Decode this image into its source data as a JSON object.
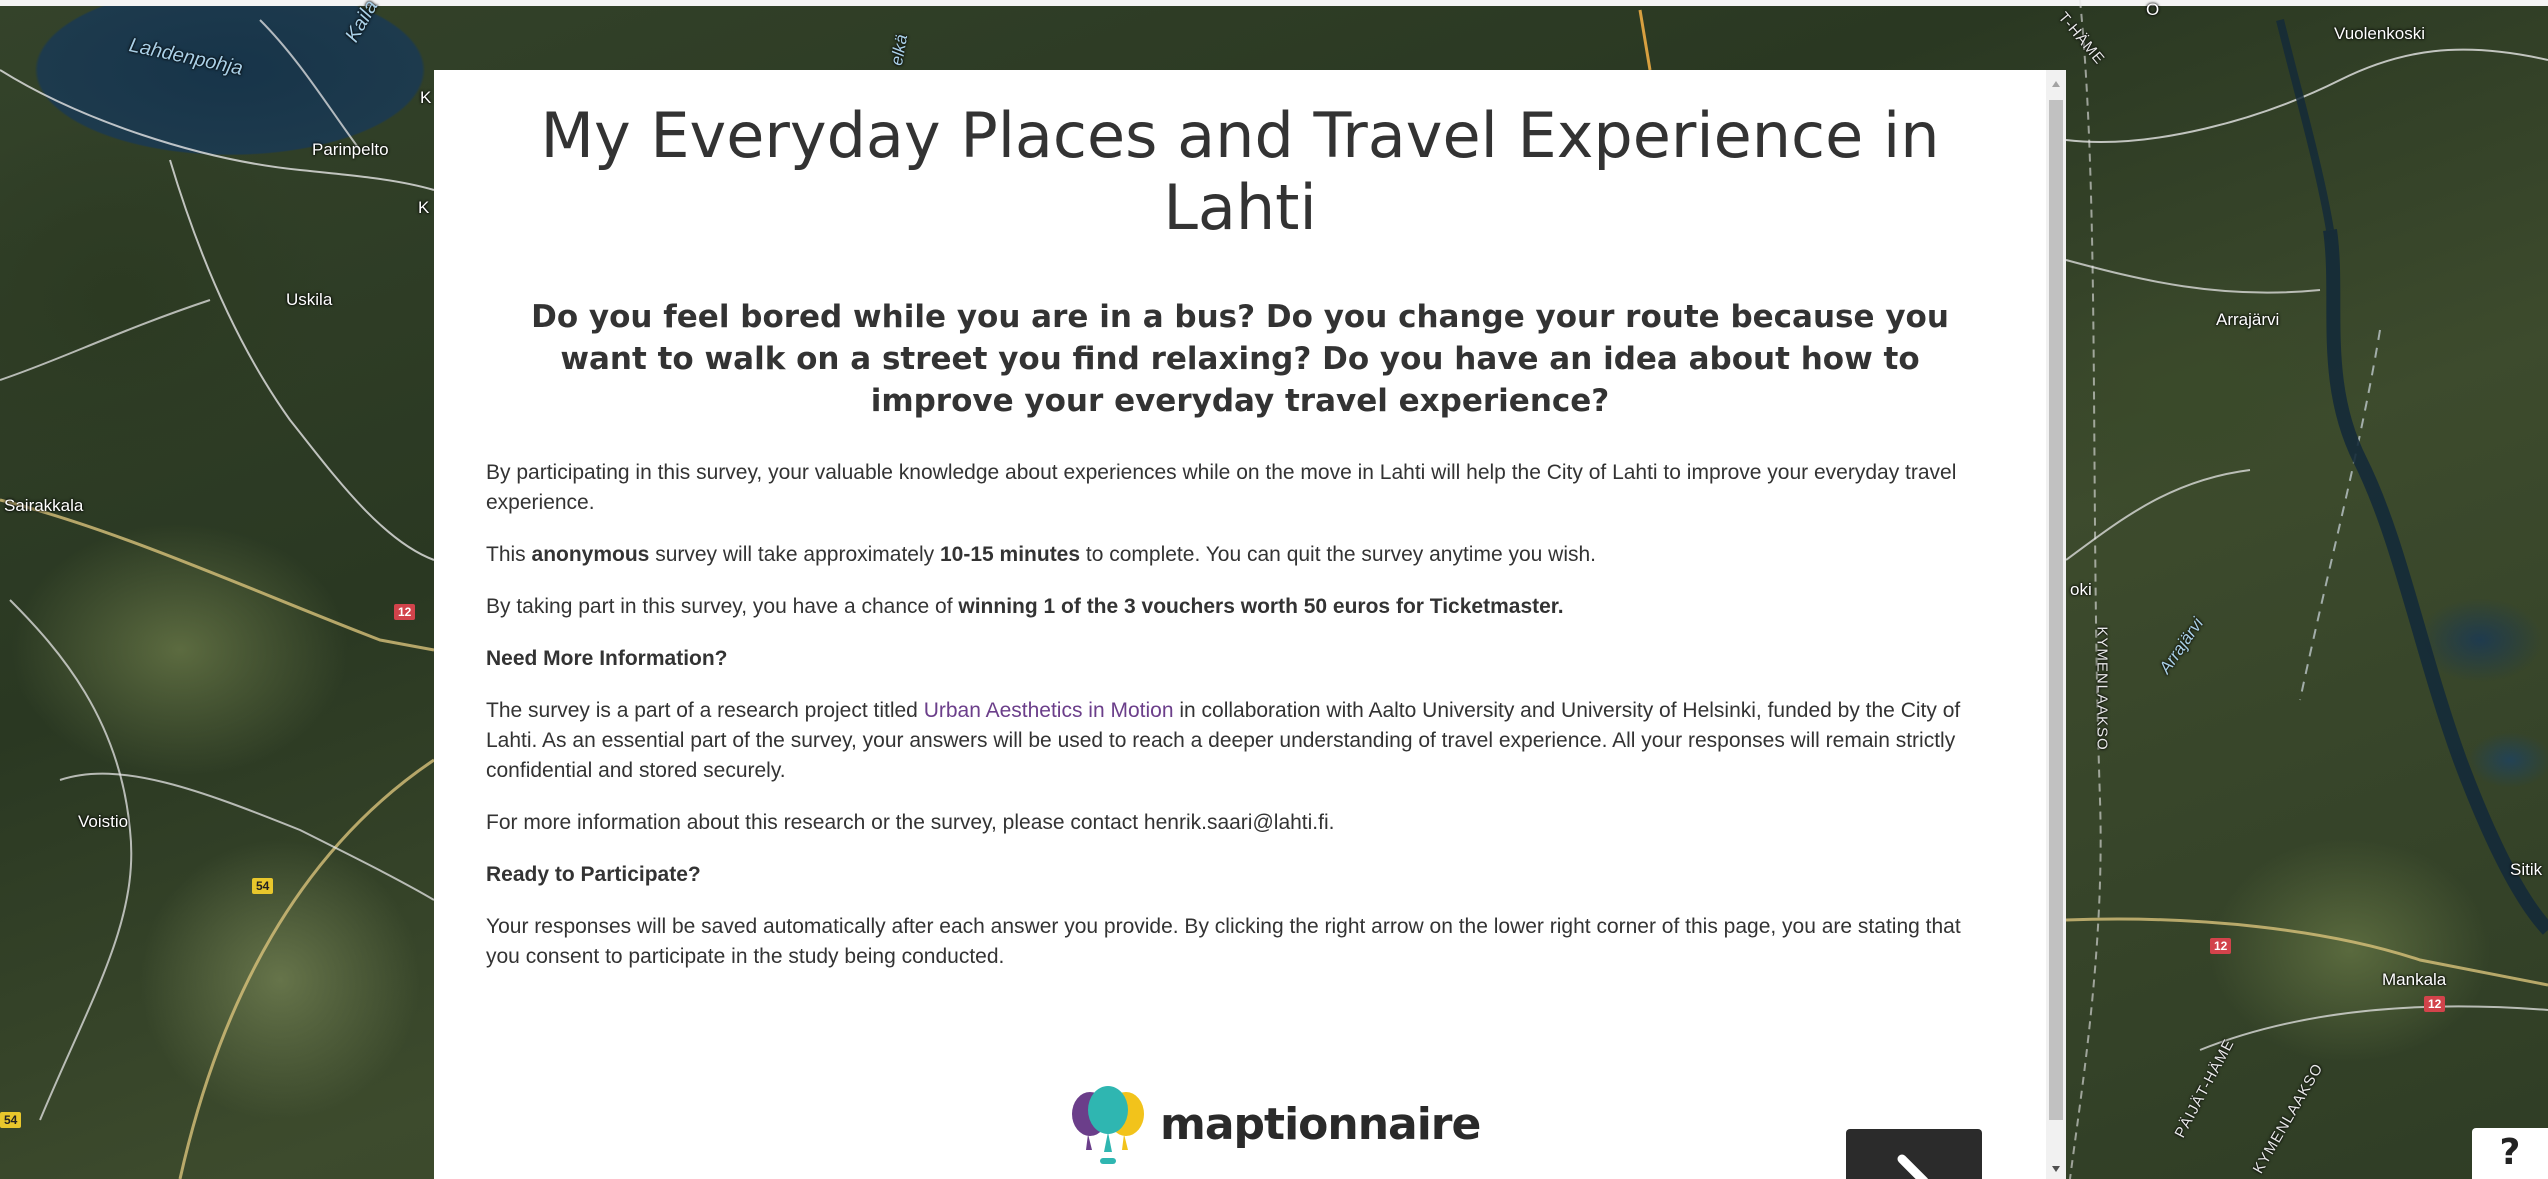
{
  "map": {
    "places": [
      {
        "id": "lahdenpohja",
        "text": "Lahdenpohja"
      },
      {
        "id": "kaila",
        "text": "Kaila"
      },
      {
        "id": "parinpelto",
        "text": "Parinpelto"
      },
      {
        "id": "uskila",
        "text": "Uskila"
      },
      {
        "id": "sairakkala",
        "text": "Sairakkala"
      },
      {
        "id": "voistio",
        "text": "Voistio"
      },
      {
        "id": "vuolenkoski",
        "text": "Vuolenkoski"
      },
      {
        "id": "arrajarvi",
        "text": "Arrajärvi"
      },
      {
        "id": "arrajarvi-lake",
        "text": "Arrajärvi"
      },
      {
        "id": "kymenlaakso",
        "text": "KYMENLAAKSO"
      },
      {
        "id": "kymenlaakso2",
        "text": "KYMENLAAKSO"
      },
      {
        "id": "paijat-hame",
        "text": "PÄIJÄT-HÄME"
      },
      {
        "id": "hame-top",
        "text": "T-HÄME"
      },
      {
        "id": "mankala",
        "text": "Mankala"
      },
      {
        "id": "sitik",
        "text": "Sitik"
      },
      {
        "id": "oki",
        "text": "oki"
      },
      {
        "id": "k1",
        "text": "K"
      },
      {
        "id": "k2",
        "text": "K"
      },
      {
        "id": "elka",
        "text": "elkä"
      },
      {
        "id": "o-top",
        "text": "O"
      }
    ],
    "road_shields": [
      {
        "id": "r12a",
        "text": "12",
        "color": "#d2434b"
      },
      {
        "id": "r54a",
        "text": "54",
        "color": "#e8c72c"
      },
      {
        "id": "r54b",
        "text": "54",
        "color": "#e8c72c"
      },
      {
        "id": "r12b",
        "text": "12",
        "color": "#d2434b"
      },
      {
        "id": "r12c",
        "text": "12",
        "color": "#d2434b"
      }
    ]
  },
  "survey": {
    "title": "My Everyday Places and Travel Experience in Lahti",
    "intro_question": "Do you feel bored while you are in a bus? Do you change your route because you want to walk on a street you find relaxing? Do you have an idea about how to improve your everyday travel experience?",
    "p1": "By participating in this survey, your valuable knowledge about experiences while on the move in Lahti will help the City of Lahti to improve your everyday travel experience.",
    "p2": {
      "a": "This ",
      "b": "anonymous",
      "c": " survey will take approximately ",
      "d": "10-15 minutes",
      "e": " to complete. You can quit the survey anytime you wish."
    },
    "p3": {
      "a": "By taking part in this survey, you have a chance of ",
      "b": "winning 1 of the 3 vouchers worth 50 euros for Ticketmaster."
    },
    "heading_more_info": "Need More Information?",
    "p4": {
      "a": "The survey is a part of a research project titled ",
      "link": "Urban Aesthetics in Motion",
      "b": " in collaboration with Aalto University and University of Helsinki, funded by the City of Lahti. As an essential part of the survey, your answers will be used to reach a deeper understanding of travel experience. All your responses will remain strictly confidential and stored securely."
    },
    "p5": "For more information about this research or the survey, please contact henrik.saari@lahti.fi.",
    "heading_ready": "Ready to Participate?",
    "p6": "Your responses will be saved automatically after each answer you provide. By clicking the right arrow on the lower right corner of this page, you are stating that you consent to participate in the study being conducted.",
    "brand": "maptionnaire",
    "next_icon": "chevron-right-icon"
  },
  "help": {
    "label": "?"
  },
  "colors": {
    "link": "#6b3e8a",
    "next_button": "#2b2b2b",
    "road_red": "#d2434b",
    "road_yellow": "#e8c72c"
  }
}
